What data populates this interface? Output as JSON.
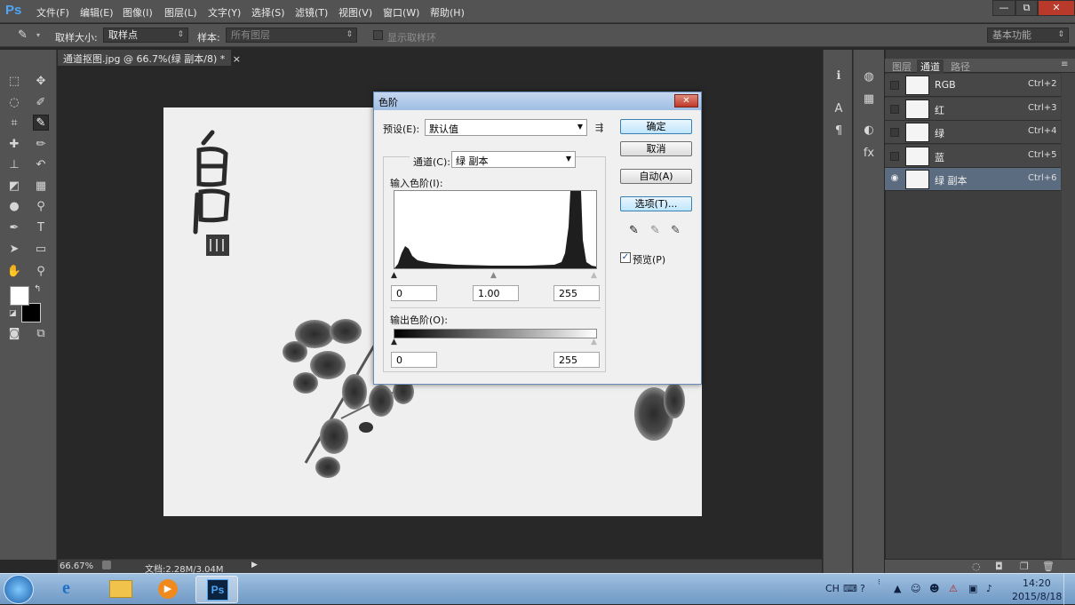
{
  "app": {
    "logo": "Ps"
  },
  "menu": [
    "文件(F)",
    "编辑(E)",
    "图像(I)",
    "图层(L)",
    "文字(Y)",
    "选择(S)",
    "滤镜(T)",
    "视图(V)",
    "窗口(W)",
    "帮助(H)"
  ],
  "window_controls": {
    "minimize": "—",
    "restore": "⧉",
    "close": "✕"
  },
  "options": {
    "sample_size_label": "取样大小:",
    "sample_size_value": "取样点",
    "sample_label": "样本:",
    "sample_value": "所有图层",
    "show_ring_label": "显示取样环",
    "workspace": "基本功能"
  },
  "document": {
    "tab_title": "通道抠图.jpg @ 66.7%(绿 副本/8) *",
    "close_glyph": "×"
  },
  "status": {
    "zoom": "66.67%",
    "doc_info": "文档:2.28M/3.04M"
  },
  "panel": {
    "tabs": [
      "图层",
      "通道",
      "路径"
    ],
    "active_tab": "通道",
    "channels": [
      {
        "name": "RGB",
        "shortcut": "Ctrl+2",
        "visible": false,
        "selected": false
      },
      {
        "name": "红",
        "shortcut": "Ctrl+3",
        "visible": false,
        "selected": false
      },
      {
        "name": "绿",
        "shortcut": "Ctrl+4",
        "visible": false,
        "selected": false
      },
      {
        "name": "蓝",
        "shortcut": "Ctrl+5",
        "visible": false,
        "selected": false
      },
      {
        "name": "绿 副本",
        "shortcut": "Ctrl+6",
        "visible": true,
        "selected": true
      }
    ]
  },
  "dialog": {
    "title": "色阶",
    "close_glyph": "✕",
    "preset_label": "预设(E):",
    "preset_value": "默认值",
    "channel_label": "通道(C):",
    "channel_value": "绿 副本",
    "input_levels_label": "输入色阶(I):",
    "input_black": "0",
    "input_gamma": "1.00",
    "input_white": "255",
    "output_levels_label": "输出色阶(O):",
    "output_black": "0",
    "output_white": "255",
    "buttons": {
      "ok": "确定",
      "cancel": "取消",
      "auto": "自动(A)",
      "options": "选项(T)..."
    },
    "preview_label": "预览(P)",
    "preview_checked": true
  },
  "taskbar": {
    "lang": "CH",
    "time": "14:20",
    "date": "2015/8/18"
  },
  "colors": {
    "ui_gray": "#535353",
    "canvas_bg": "#282828",
    "selected_channel": "#5b6b80",
    "accent_ps": "#4ea5f5"
  }
}
